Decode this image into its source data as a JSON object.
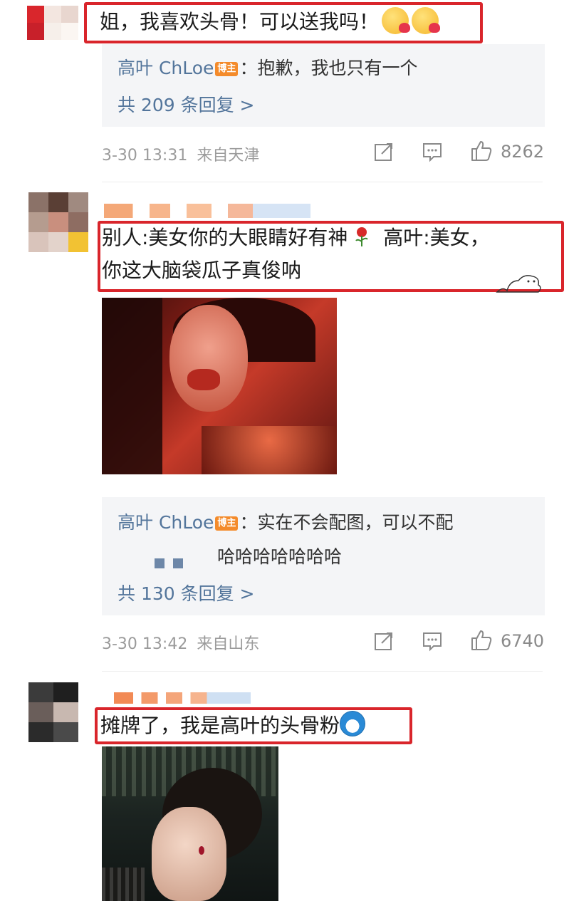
{
  "comments": [
    {
      "text": "姐，我喜欢头骨！可以送我吗！",
      "reply": {
        "author": "高叶 ChLoe",
        "badge": "博主",
        "text": "：抱歉，我也只有一个"
      },
      "more_replies": "共 209 条回复 >",
      "time": "3-30 13:31",
      "location": "来自天津",
      "likes": "8262"
    },
    {
      "text_line1": "别人:美女你的大眼睛好有神",
      "text_line1b": "高叶:美女，",
      "text_line2": "你这大脑袋瓜子真俊呐",
      "reply": {
        "author": "高叶 ChLoe",
        "badge": "博主",
        "text": "：实在不会配图，可以不配",
        "text2": "哈哈哈哈哈哈哈"
      },
      "more_replies": "共 130 条回复 >",
      "time": "3-30 13:42",
      "location": "来自山东",
      "likes": "6740"
    },
    {
      "text": "摊牌了，我是高叶的头骨粉"
    }
  ],
  "icons": {
    "repost": "repost-icon",
    "comment": "comment-icon",
    "like": "thumbs-up-icon"
  },
  "colors": {
    "highlight": "#d9252b",
    "link": "#53759b",
    "badge": "#f48b2b"
  }
}
